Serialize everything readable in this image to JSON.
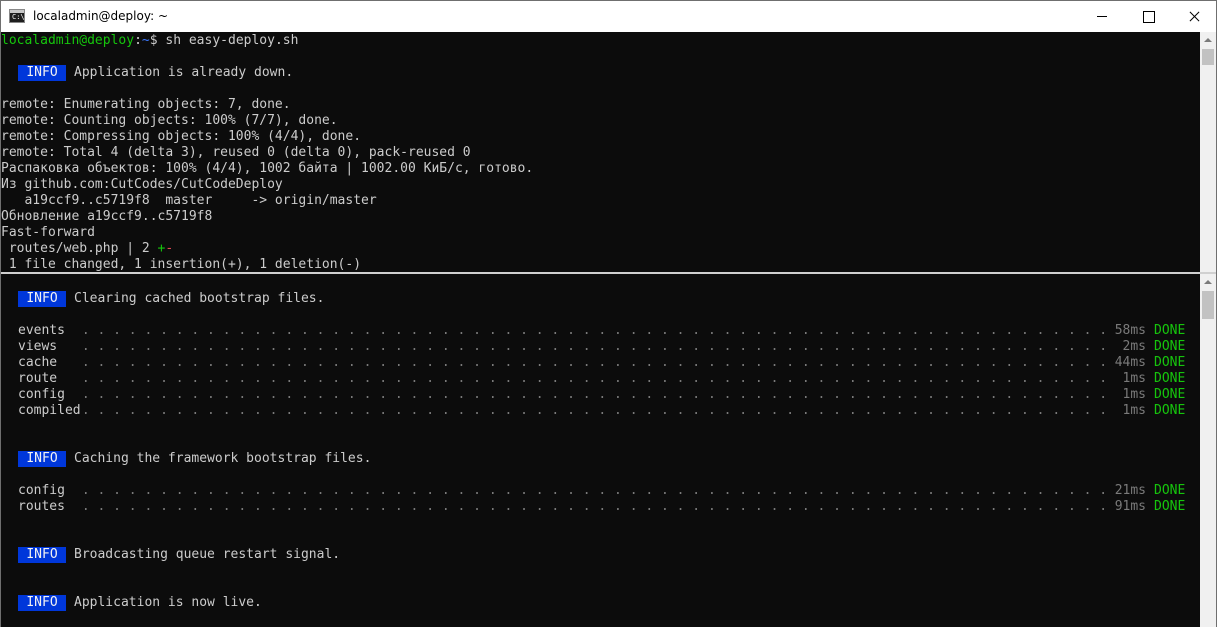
{
  "window": {
    "title": "localadmin@deploy: ~",
    "icon_name": "console-icon",
    "icon_glyph": "C:\\"
  },
  "top": {
    "prompt_user": "localadmin@deploy",
    "prompt_colon": ":",
    "prompt_path": "~",
    "prompt_symbol": "$ ",
    "command": "sh easy-deploy.sh",
    "info_badge": "INFO",
    "info_message": "Application is already down.",
    "git_lines": [
      "remote: Enumerating objects: 7, done.",
      "remote: Counting objects: 100% (7/7), done.",
      "remote: Compressing objects: 100% (4/4), done.",
      "remote: Total 4 (delta 3), reused 0 (delta 0), pack-reused 0",
      "Распаковка объектов: 100% (4/4), 1002 байта | 1002.00 КиБ/с, готово.",
      "Из github.com:CutCodes/CutCodeDeploy",
      "   a19ccf9..c5719f8  master     -> origin/master",
      "Обновление a19ccf9..c5719f8",
      "Fast-forward"
    ],
    "diffstat_file": " routes/web.php | 2 ",
    "diffstat_plus": "+",
    "diffstat_minus": "-",
    "summary": " 1 file changed, 1 insertion(+), 1 deletion(-)"
  },
  "bottom": {
    "sections": [
      {
        "badge": "INFO",
        "message": "Clearing cached bootstrap files.",
        "tasks": [
          {
            "name": "events",
            "time": "58ms",
            "status": "DONE"
          },
          {
            "name": "views",
            "time": "2ms",
            "status": "DONE"
          },
          {
            "name": "cache",
            "time": "44ms",
            "status": "DONE"
          },
          {
            "name": "route",
            "time": "1ms",
            "status": "DONE"
          },
          {
            "name": "config",
            "time": "1ms",
            "status": "DONE"
          },
          {
            "name": "compiled",
            "time": "1ms",
            "status": "DONE"
          }
        ]
      },
      {
        "badge": "INFO",
        "message": "Caching the framework bootstrap files.",
        "tasks": [
          {
            "name": "config",
            "time": "21ms",
            "status": "DONE"
          },
          {
            "name": "routes",
            "time": "91ms",
            "status": "DONE"
          }
        ]
      },
      {
        "badge": "INFO",
        "message": "Broadcasting queue restart signal.",
        "tasks": []
      },
      {
        "badge": "INFO",
        "message": "Application is now live.",
        "tasks": []
      }
    ]
  },
  "colors": {
    "background": "#0c0c0c",
    "text": "#cccccc",
    "prompt_green": "#16c60c",
    "prompt_blue": "#3b78ff",
    "info_badge_bg": "#0037da",
    "dots_gray": "#7a7a7a",
    "diff_red": "#e74856"
  }
}
